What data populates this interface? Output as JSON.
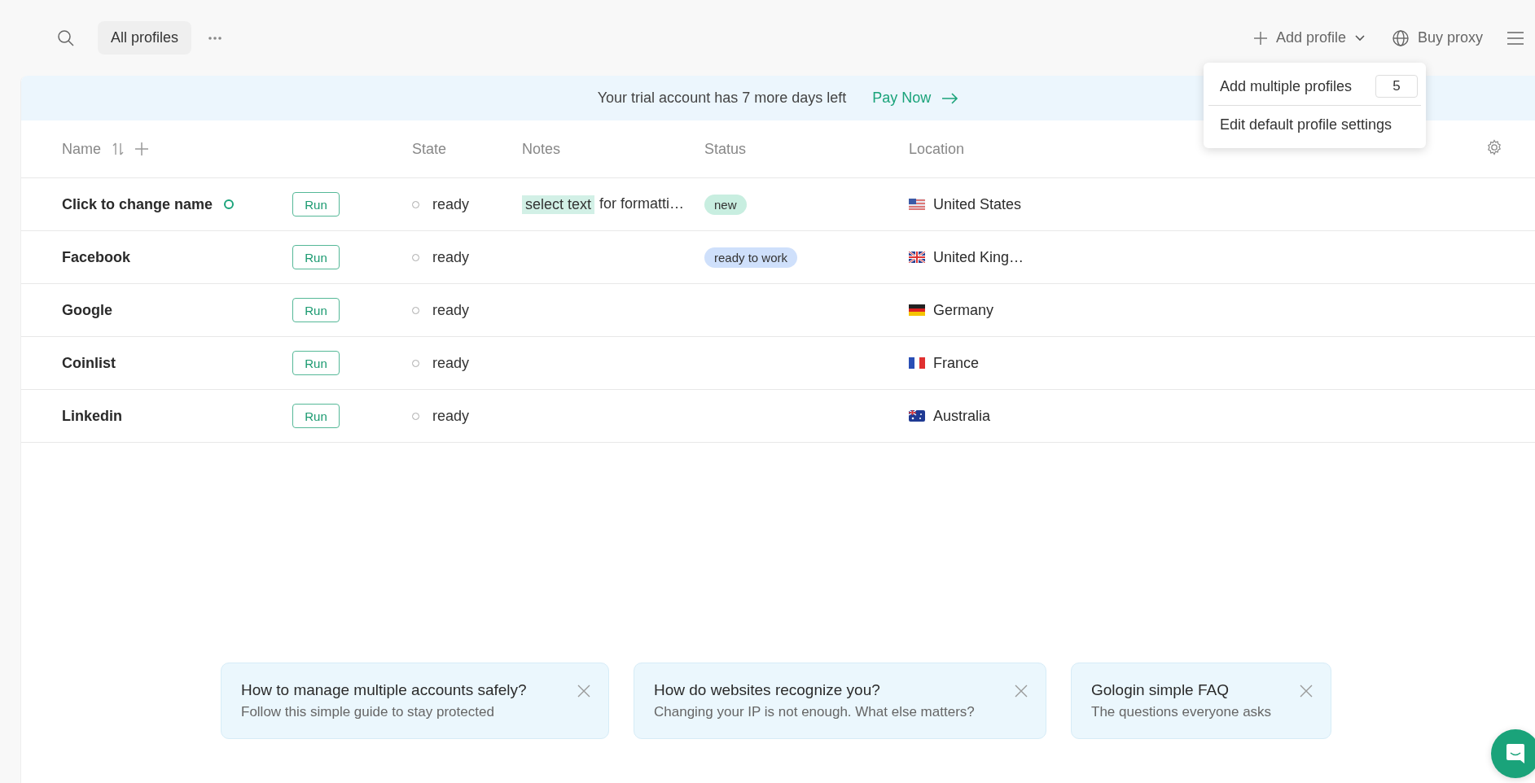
{
  "toolbar": {
    "filter": "All profiles",
    "add_profile": "Add profile",
    "buy_proxy": "Buy proxy"
  },
  "add_menu": {
    "items": [
      {
        "kind": "count",
        "label": "Add multiple profiles",
        "value": "5"
      },
      {
        "kind": "plain",
        "label": "Edit default profile settings"
      }
    ]
  },
  "banner": {
    "text": "Your trial account has 7 more days left",
    "link": "Pay Now"
  },
  "table": {
    "columns": [
      "Name",
      "State",
      "Notes",
      "Status",
      "Location"
    ],
    "rows": [
      {
        "name": "Click to change name",
        "marked": true,
        "run": "Run",
        "state": "ready",
        "notes": {
          "highlight": "select text",
          "text": "for formatti…"
        },
        "status": {
          "label": "new",
          "color": "#c8eee0"
        },
        "location": {
          "kind": "us",
          "name": "United States"
        }
      },
      {
        "name": "Facebook",
        "marked": false,
        "run": "Run",
        "state": "ready",
        "status": {
          "label": "ready to work",
          "color": "#cfe0fb"
        },
        "location": {
          "kind": "gb",
          "name": "United King…"
        }
      },
      {
        "name": "Google",
        "marked": false,
        "run": "Run",
        "state": "ready",
        "location": {
          "kind": "de",
          "name": "Germany"
        }
      },
      {
        "name": "Coinlist",
        "marked": false,
        "run": "Run",
        "state": "ready",
        "location": {
          "kind": "fr",
          "name": "France"
        }
      },
      {
        "name": "Linkedin",
        "marked": false,
        "run": "Run",
        "state": "ready",
        "location": {
          "kind": "au",
          "name": "Australia"
        }
      }
    ]
  },
  "tips": [
    {
      "title": "How to manage multiple accounts safely?",
      "text": "Follow this simple guide to stay protected"
    },
    {
      "title": "How do websites recognize you?",
      "text": "Changing your IP is not enough. What else matters?"
    },
    {
      "title": "Gologin simple FAQ",
      "text": "The questions everyone asks"
    }
  ]
}
